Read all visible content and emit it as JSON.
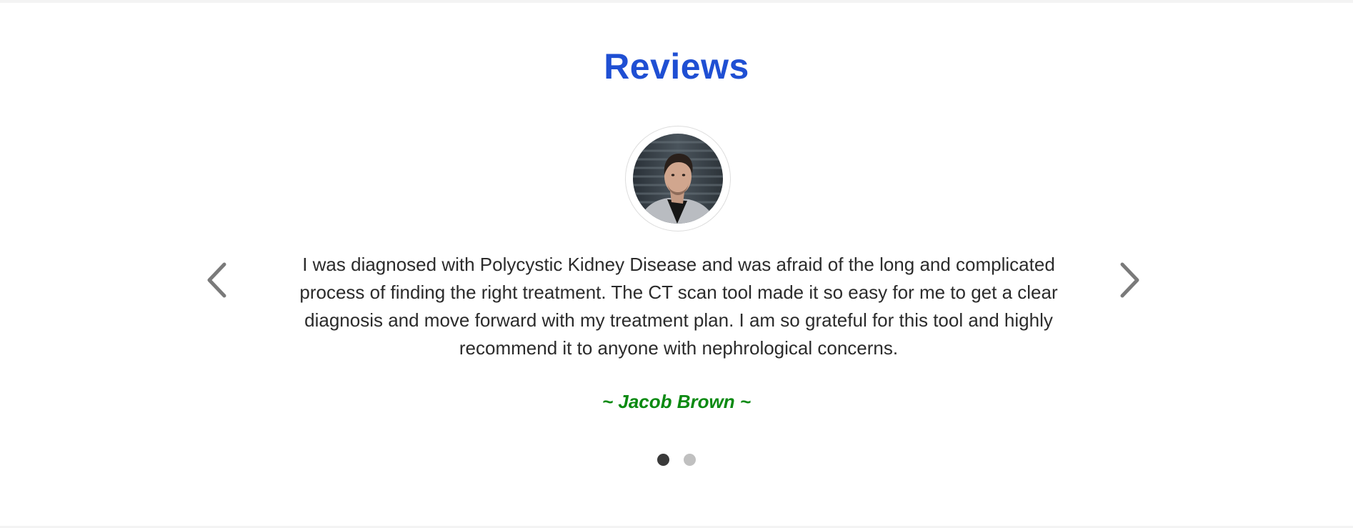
{
  "section": {
    "title": "Reviews"
  },
  "review": {
    "avatar_icon": "user-portrait",
    "text": "I was diagnosed with Polycystic Kidney Disease and was afraid of the long and complicated process of finding the right treatment. The CT scan tool made it so easy for me to get a clear diagnosis and move forward with my treatment plan. I am so grateful for this tool and highly recommend it to anyone with nephrological concerns.",
    "author": "~ Jacob Brown ~"
  },
  "carousel": {
    "prev_icon": "chevron-left-icon",
    "next_icon": "chevron-right-icon",
    "slide_count": 2,
    "active_index": 0
  },
  "colors": {
    "title": "#1f4fd3",
    "author": "#0b8a12",
    "text": "#2b2b2b",
    "arrow": "#7a7a7a",
    "dot_active": "#3a3a3a",
    "dot_inactive": "#c0c0c0"
  }
}
